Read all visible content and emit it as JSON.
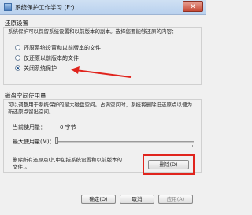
{
  "window": {
    "title": "系统保护工作学习 (E:)",
    "close_label": "✕"
  },
  "restore_settings": {
    "heading": "还原设置",
    "description": "系统保护可以保留系统设置和以前版本的副本。选择您要能够还原的内容：",
    "options": [
      {
        "label": "还原系统设置和以前版本的文件",
        "selected": false
      },
      {
        "label": "仅还原以前版本的文件",
        "selected": false
      },
      {
        "label": "关闭系统保护",
        "selected": true
      }
    ]
  },
  "disk_usage": {
    "heading": "磁盘空间使用量",
    "description": "可以调整用于系统保护的最大磁盘空间。占满空间时，系统将删除旧还原点以便为新还原点留出空间。",
    "current_label": "当前使用量：",
    "current_value": "0 字节",
    "max_label": "最大使用量(M)：",
    "max_usage_fraction": 0
  },
  "delete_section": {
    "description": "删除所有还原点(其中包括系统设置和以前版本的文件)。",
    "delete_button": "删除(D)"
  },
  "footer": {
    "ok": "确定(O)",
    "cancel": "取消",
    "apply": "应用(A)"
  },
  "annotation_color": "#e0241d"
}
